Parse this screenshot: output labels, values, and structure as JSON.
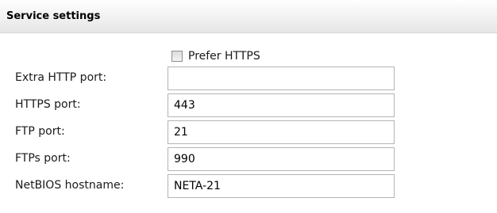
{
  "panel": {
    "title": "Service settings"
  },
  "prefer_https": {
    "label": "Prefer HTTPS",
    "checked": false
  },
  "fields": [
    {
      "label": "Extra HTTP port:",
      "value": ""
    },
    {
      "label": "HTTPS port:",
      "value": "443"
    },
    {
      "label": "FTP port:",
      "value": "21"
    },
    {
      "label": "FTPs port:",
      "value": "990"
    },
    {
      "label": "NetBIOS hostname:",
      "value": "NETA-21"
    }
  ]
}
